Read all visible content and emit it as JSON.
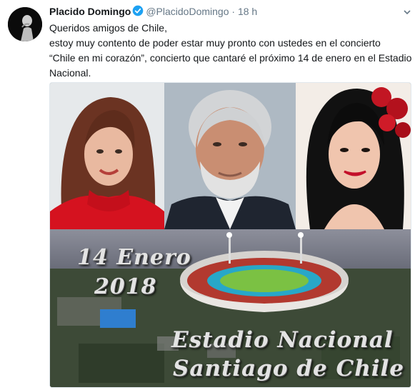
{
  "tweet": {
    "author_name": "Placido Domingo",
    "handle": "@PlacidoDomingo",
    "separator": "·",
    "time": "18 h",
    "text_lines": [
      "Queridos amigos de Chile,",
      " estoy muy contento de poder estar muy pronto con ustedes en el concierto",
      "“Chile en mi corazón”, concierto que cantaré el próximo 14 de enero en el Estadio",
      "Nacional."
    ]
  },
  "media": {
    "overlay_date": "14 Enero",
    "overlay_year": "2018",
    "overlay_place_1": "Estadio Nacional",
    "overlay_place_2": "Santiago de Chile"
  },
  "colors": {
    "verified": "#1da1f2",
    "secondary_text": "#657786",
    "primary_text": "#14171a"
  },
  "icons": [
    "verified-badge-icon",
    "chevron-down-icon"
  ]
}
